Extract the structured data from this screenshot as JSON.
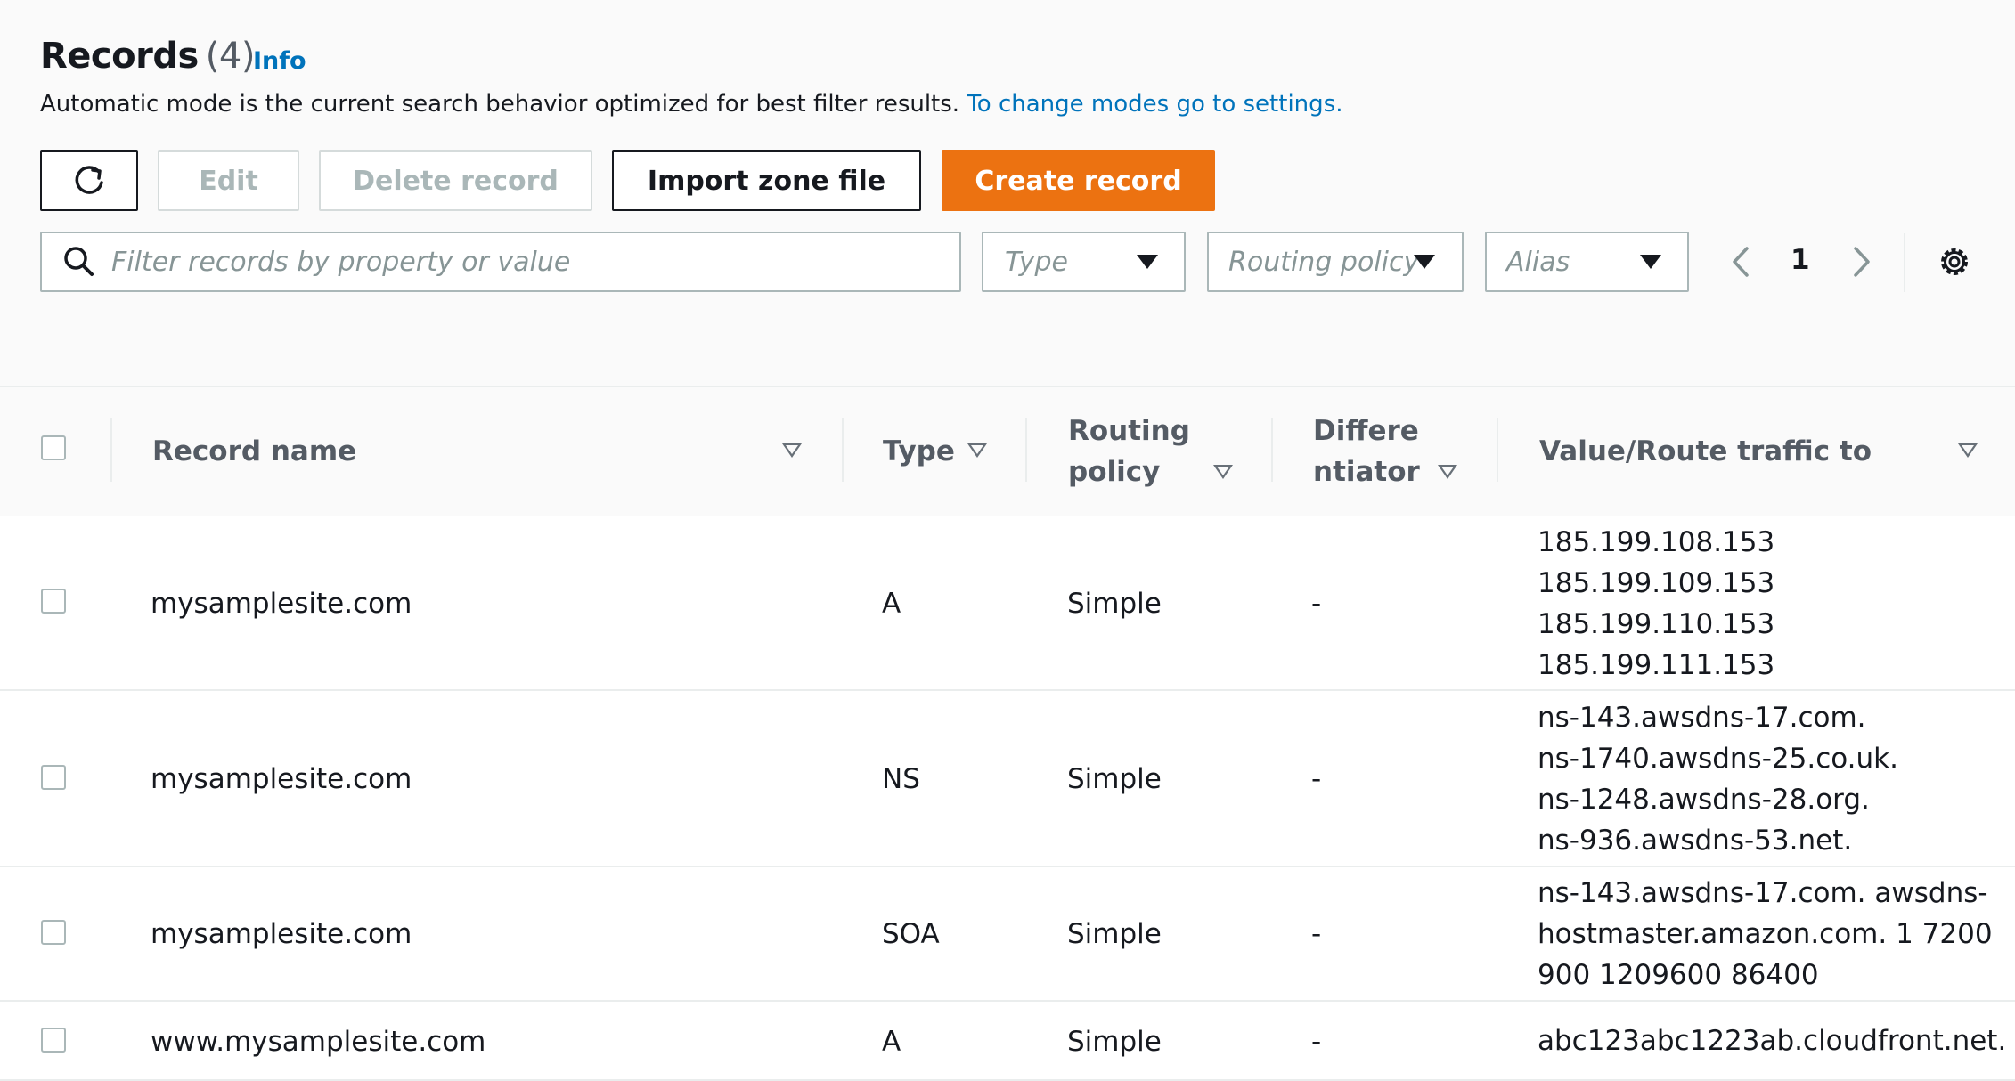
{
  "header": {
    "title": "Records",
    "count": "(4)",
    "info_label": "Info",
    "description": "Automatic mode is the current search behavior optimized for best filter results.",
    "settings_link": "To change modes go to settings."
  },
  "toolbar": {
    "refresh_icon": "refresh-icon",
    "edit_label": "Edit",
    "delete_label": "Delete record",
    "import_label": "Import zone file",
    "create_label": "Create record",
    "primary_color": "#ec7211"
  },
  "filters": {
    "search_placeholder": "Filter records by property or value",
    "type_placeholder": "Type",
    "routing_placeholder": "Routing policy",
    "alias_placeholder": "Alias"
  },
  "pagination": {
    "current_page": "1"
  },
  "table": {
    "columns": {
      "record_name": "Record name",
      "type": "Type",
      "routing_line1": "Routing",
      "routing_line2": "policy",
      "diff_line1": "Differe",
      "diff_line2": "ntiator",
      "value": "Value/Route traffic to"
    },
    "rows": [
      {
        "name": "mysamplesite.com",
        "type": "A",
        "routing": "Simple",
        "differentiator": "-",
        "value": "185.199.108.153\n185.199.109.153\n185.199.110.153\n185.199.111.153"
      },
      {
        "name": "mysamplesite.com",
        "type": "NS",
        "routing": "Simple",
        "differentiator": "-",
        "value": "ns-143.awsdns-17.com.\nns-1740.awsdns-25.co.uk.\nns-1248.awsdns-28.org.\nns-936.awsdns-53.net."
      },
      {
        "name": "mysamplesite.com",
        "type": "SOA",
        "routing": "Simple",
        "differentiator": "-",
        "value": "ns-143.awsdns-17.com. awsdns-\nhostmaster.amazon.com. 1 7200\n900 1209600 86400"
      },
      {
        "name": "www.mysamplesite.com",
        "type": "A",
        "routing": "Simple",
        "differentiator": "-",
        "value": "abc123abc1223ab.cloudfront.net."
      }
    ]
  }
}
